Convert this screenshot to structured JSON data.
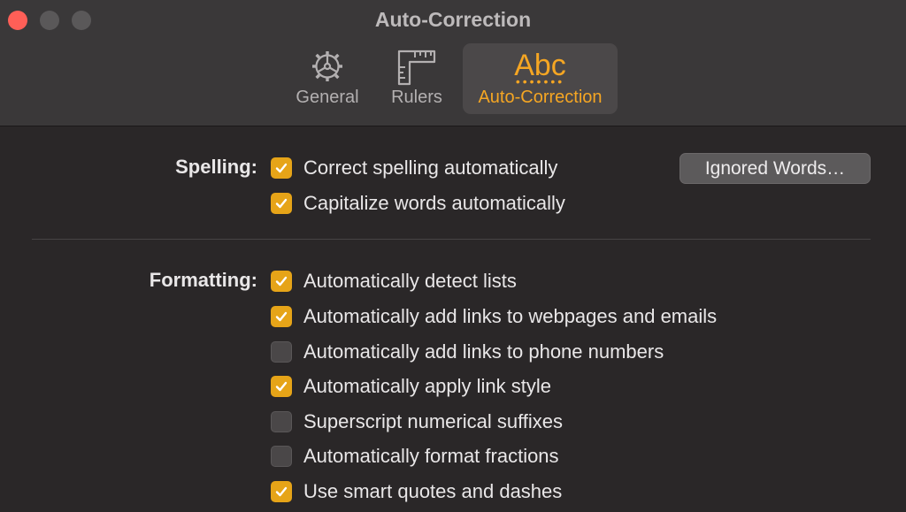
{
  "window": {
    "title": "Auto-Correction"
  },
  "toolbar": {
    "tabs": [
      {
        "label": "General",
        "icon": "gear-icon",
        "selected": false
      },
      {
        "label": "Rulers",
        "icon": "ruler-icon",
        "selected": false
      },
      {
        "label": "Auto-Correction",
        "icon": "abc-icon",
        "icon_text": "Abc",
        "selected": true
      }
    ]
  },
  "spelling": {
    "label": "Spelling:",
    "ignored_words_button": "Ignored Words…",
    "options": [
      {
        "label": "Correct spelling automatically",
        "checked": true
      },
      {
        "label": "Capitalize words automatically",
        "checked": true
      }
    ]
  },
  "formatting": {
    "label": "Formatting:",
    "options": [
      {
        "label": "Automatically detect lists",
        "checked": true
      },
      {
        "label": "Automatically add links to webpages and emails",
        "checked": true
      },
      {
        "label": "Automatically add links to phone numbers",
        "checked": false
      },
      {
        "label": "Automatically apply link style",
        "checked": true
      },
      {
        "label": "Superscript numerical suffixes",
        "checked": false
      },
      {
        "label": "Automatically format fractions",
        "checked": false
      },
      {
        "label": "Use smart quotes and dashes",
        "checked": true
      }
    ]
  },
  "colors": {
    "accent": "#f5a623",
    "checkbox_checked": "#e6a418",
    "close_button": "#ff5f57"
  }
}
